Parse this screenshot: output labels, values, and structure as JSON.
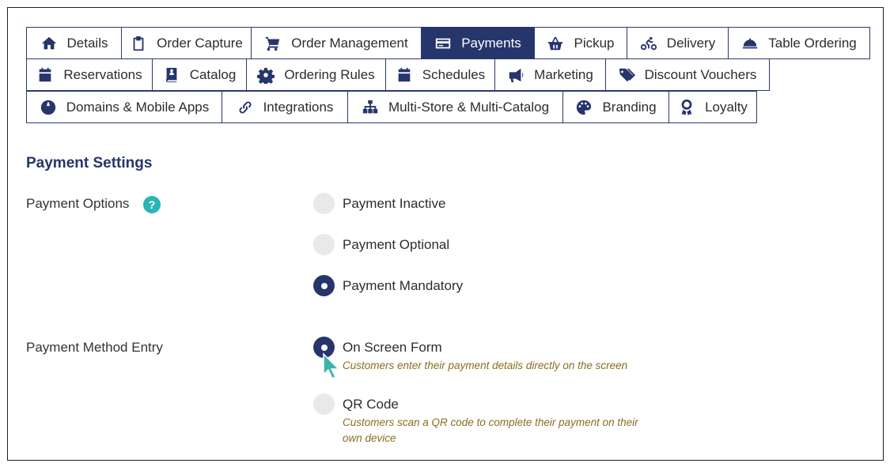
{
  "tabs_row1": [
    {
      "label": "Details",
      "icon": "home-icon"
    },
    {
      "label": "Order Capture",
      "icon": "clipboard-icon"
    },
    {
      "label": "Order Management",
      "icon": "cart-icon"
    },
    {
      "label": "Payments",
      "icon": "credit-card-icon",
      "active": true
    },
    {
      "label": "Pickup",
      "icon": "basket-icon"
    },
    {
      "label": "Delivery",
      "icon": "bicycle-icon"
    },
    {
      "label": "Table Ordering",
      "icon": "cloche-icon"
    }
  ],
  "tabs_row2": [
    {
      "label": "Reservations",
      "icon": "calendar-icon"
    },
    {
      "label": "Catalog",
      "icon": "book-icon"
    },
    {
      "label": "Ordering Rules",
      "icon": "gear-icon"
    },
    {
      "label": "Schedules",
      "icon": "calendar-icon"
    },
    {
      "label": "Marketing",
      "icon": "megaphone-icon"
    },
    {
      "label": "Discount Vouchers",
      "icon": "tags-icon"
    }
  ],
  "tabs_row3": [
    {
      "label": "Domains & Mobile Apps",
      "icon": "globe-icon"
    },
    {
      "label": "Integrations",
      "icon": "link-icon"
    },
    {
      "label": "Multi-Store & Multi-Catalog",
      "icon": "sitemap-icon"
    },
    {
      "label": "Branding",
      "icon": "palette-icon"
    },
    {
      "label": "Loyalty",
      "icon": "award-icon"
    }
  ],
  "settings": {
    "title": "Payment Settings",
    "payment_options_label": "Payment Options",
    "help_glyph": "?",
    "payment_options": [
      {
        "label": "Payment Inactive",
        "checked": false
      },
      {
        "label": "Payment Optional",
        "checked": false
      },
      {
        "label": "Payment Mandatory",
        "checked": true
      }
    ],
    "method_entry_label": "Payment Method Entry",
    "method_options": [
      {
        "label": "On Screen Form",
        "desc": "Customers enter their payment details directly on the screen",
        "checked": true
      },
      {
        "label": "QR Code",
        "desc": "Customers scan a QR code to complete their payment on their own device",
        "checked": false
      }
    ]
  },
  "colors": {
    "accent": "#26356b",
    "help": "#2bb4b4",
    "desc_text": "#8a6d1f",
    "cursor": "#3bb3a8"
  }
}
